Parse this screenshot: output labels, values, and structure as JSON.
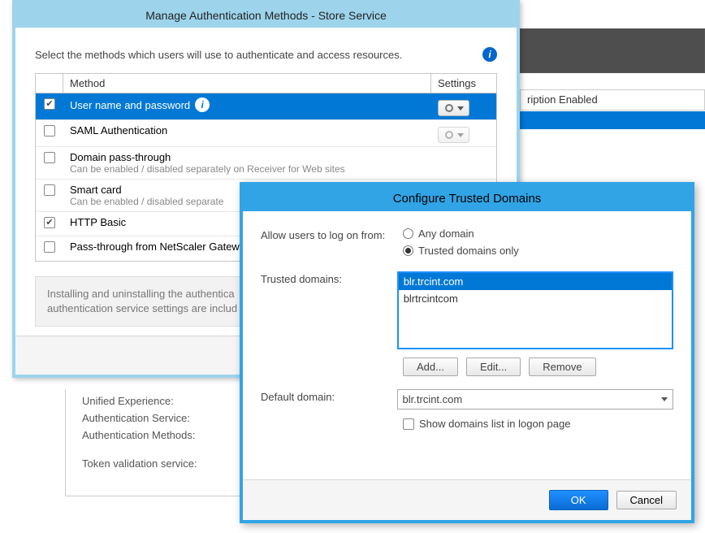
{
  "background": {
    "header_cell": "ription Enabled",
    "info": {
      "l1": "Unified Experience:",
      "l2": "Authentication Service:",
      "l3": "Authentication Methods:",
      "l4": "Token validation service:"
    }
  },
  "dlg1": {
    "title": "Manage Authentication Methods - Store Service",
    "intro": "Select the methods which users will use to authenticate and access resources.",
    "head_method": "Method",
    "head_settings": "Settings",
    "rows": {
      "r0": {
        "label": "User name and password",
        "sub": ""
      },
      "r1": {
        "label": "SAML Authentication",
        "sub": ""
      },
      "r2": {
        "label": "Domain pass-through",
        "sub": "Can be enabled / disabled separately on Receiver for Web sites"
      },
      "r3": {
        "label": "Smart card",
        "sub": "Can be enabled / disabled separate"
      },
      "r4": {
        "label": "HTTP Basic",
        "sub": ""
      },
      "r5": {
        "label": "Pass-through from NetScaler Gatew",
        "sub": ""
      }
    },
    "note": "Installing and uninstalling the authentica\nauthentication service settings are includ"
  },
  "dlg2": {
    "title": "Configure Trusted Domains",
    "allow_label": "Allow users to log on from:",
    "opt_any": "Any domain",
    "opt_trusted": "Trusted domains only",
    "trusted_label": "Trusted domains:",
    "items": {
      "i0": "blr.trcint.com",
      "i1": "blrtrcintcom"
    },
    "add": "Add...",
    "edit": "Edit...",
    "remove": "Remove",
    "default_label": "Default domain:",
    "default_value": "blr.trcint.com",
    "show_list": "Show domains list in logon page",
    "ok": "OK",
    "cancel": "Cancel"
  }
}
